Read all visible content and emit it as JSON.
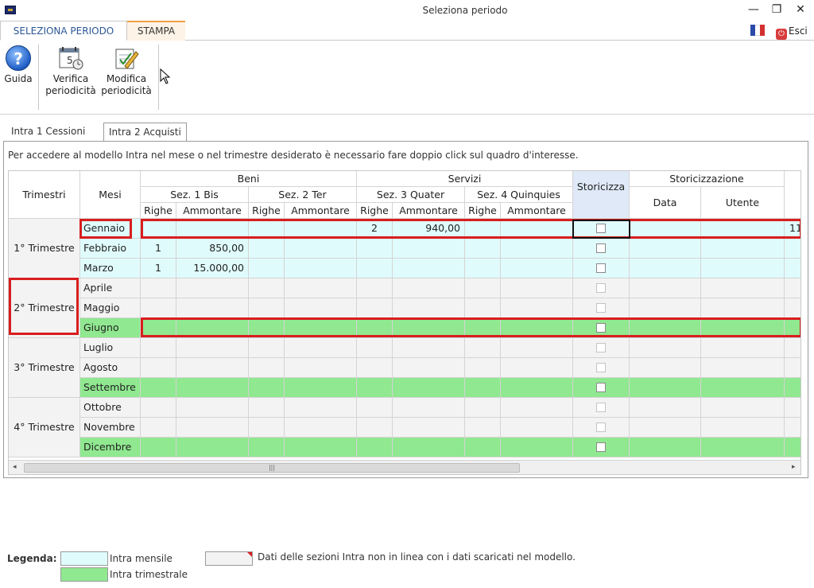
{
  "window": {
    "title": "Seleziona periodo",
    "minimize": "—",
    "restore": "❐",
    "close": "✕"
  },
  "ribbon": {
    "tabs": [
      {
        "label": "SELEZIONA PERIODO",
        "active": true
      },
      {
        "label": "STAMPA",
        "active": false
      }
    ],
    "esci_label": "Esci",
    "buttons": [
      {
        "label_line1": "Guida",
        "label_line2": "",
        "icon": "help-icon"
      },
      {
        "label_line1": "Verifica",
        "label_line2": "periodicità",
        "icon": "calendar-icon"
      },
      {
        "label_line1": "Modifica",
        "label_line2": "periodicità",
        "icon": "edit-pencil-icon"
      }
    ]
  },
  "tabs": [
    {
      "label": "Intra 1 Cessioni",
      "active": false
    },
    {
      "label": "Intra 2 Acquisti",
      "active": true
    }
  ],
  "info_text": "Per accedere al modello Intra nel mese o nel trimestre desiderato è necessario fare doppio click sul quadro d'interesse.",
  "grid": {
    "headers": {
      "trimestri": "Trimestri",
      "mesi": "Mesi",
      "beni": "Beni",
      "servizi": "Servizi",
      "storicizza": "Storicizza",
      "storicizzazione": "Storicizzazione",
      "sez1": "Sez. 1 Bis",
      "sez2": "Sez. 2 Ter",
      "sez3": "Sez. 3 Quater",
      "sez4": "Sez. 4 Quinquies",
      "data": "Data",
      "utente": "Utente",
      "righe": "Righe",
      "ammontare": "Ammontare"
    },
    "quarters": [
      "1° Trimestre",
      "2° Trimestre",
      "3° Trimestre",
      "4° Trimestre"
    ],
    "rows": [
      {
        "month": "Gennaio",
        "type": "mensile",
        "s1_righe": "",
        "s1_amm": "",
        "s3_righe": "2",
        "s3_amm": "940,00",
        "extra": "11"
      },
      {
        "month": "Febbraio",
        "type": "mensile",
        "s1_righe": "1",
        "s1_amm": "850,00",
        "s3_righe": "",
        "s3_amm": "",
        "extra": ""
      },
      {
        "month": "Marzo",
        "type": "mensile",
        "s1_righe": "1",
        "s1_amm": "15.000,00",
        "s3_righe": "",
        "s3_amm": "",
        "extra": ""
      },
      {
        "month": "Aprile",
        "type": "none",
        "s1_righe": "",
        "s1_amm": "",
        "s3_righe": "",
        "s3_amm": "",
        "extra": ""
      },
      {
        "month": "Maggio",
        "type": "none",
        "s1_righe": "",
        "s1_amm": "",
        "s3_righe": "",
        "s3_amm": "",
        "extra": ""
      },
      {
        "month": "Giugno",
        "type": "trimestrale",
        "s1_righe": "",
        "s1_amm": "",
        "s3_righe": "",
        "s3_amm": "",
        "extra": ""
      },
      {
        "month": "Luglio",
        "type": "none",
        "s1_righe": "",
        "s1_amm": "",
        "s3_righe": "",
        "s3_amm": "",
        "extra": ""
      },
      {
        "month": "Agosto",
        "type": "none",
        "s1_righe": "",
        "s1_amm": "",
        "s3_righe": "",
        "s3_amm": "",
        "extra": ""
      },
      {
        "month": "Settembre",
        "type": "trimestrale",
        "s1_righe": "",
        "s1_amm": "",
        "s3_righe": "",
        "s3_amm": "",
        "extra": ""
      },
      {
        "month": "Ottobre",
        "type": "none",
        "s1_righe": "",
        "s1_amm": "",
        "s3_righe": "",
        "s3_amm": "",
        "extra": ""
      },
      {
        "month": "Novembre",
        "type": "none",
        "s1_righe": "",
        "s1_amm": "",
        "s3_righe": "",
        "s3_amm": "",
        "extra": ""
      },
      {
        "month": "Dicembre",
        "type": "trimestrale",
        "s1_righe": "",
        "s1_amm": "",
        "s3_righe": "",
        "s3_amm": "",
        "extra": ""
      }
    ],
    "scroll_grip": "|||"
  },
  "legend": {
    "title": "Legenda:",
    "mensile": "Intra mensile",
    "trimestrale": "Intra trimestrale",
    "non_in_linea": "Dati delle sezioni Intra non in linea con i dati scaricati nel modello."
  },
  "colors": {
    "mensile": "#e0fbfb",
    "trimestrale": "#90e890",
    "none": "#f3f3f3",
    "highlight_red": "#d81e1e",
    "ribbon_accent": "#2b5797"
  }
}
